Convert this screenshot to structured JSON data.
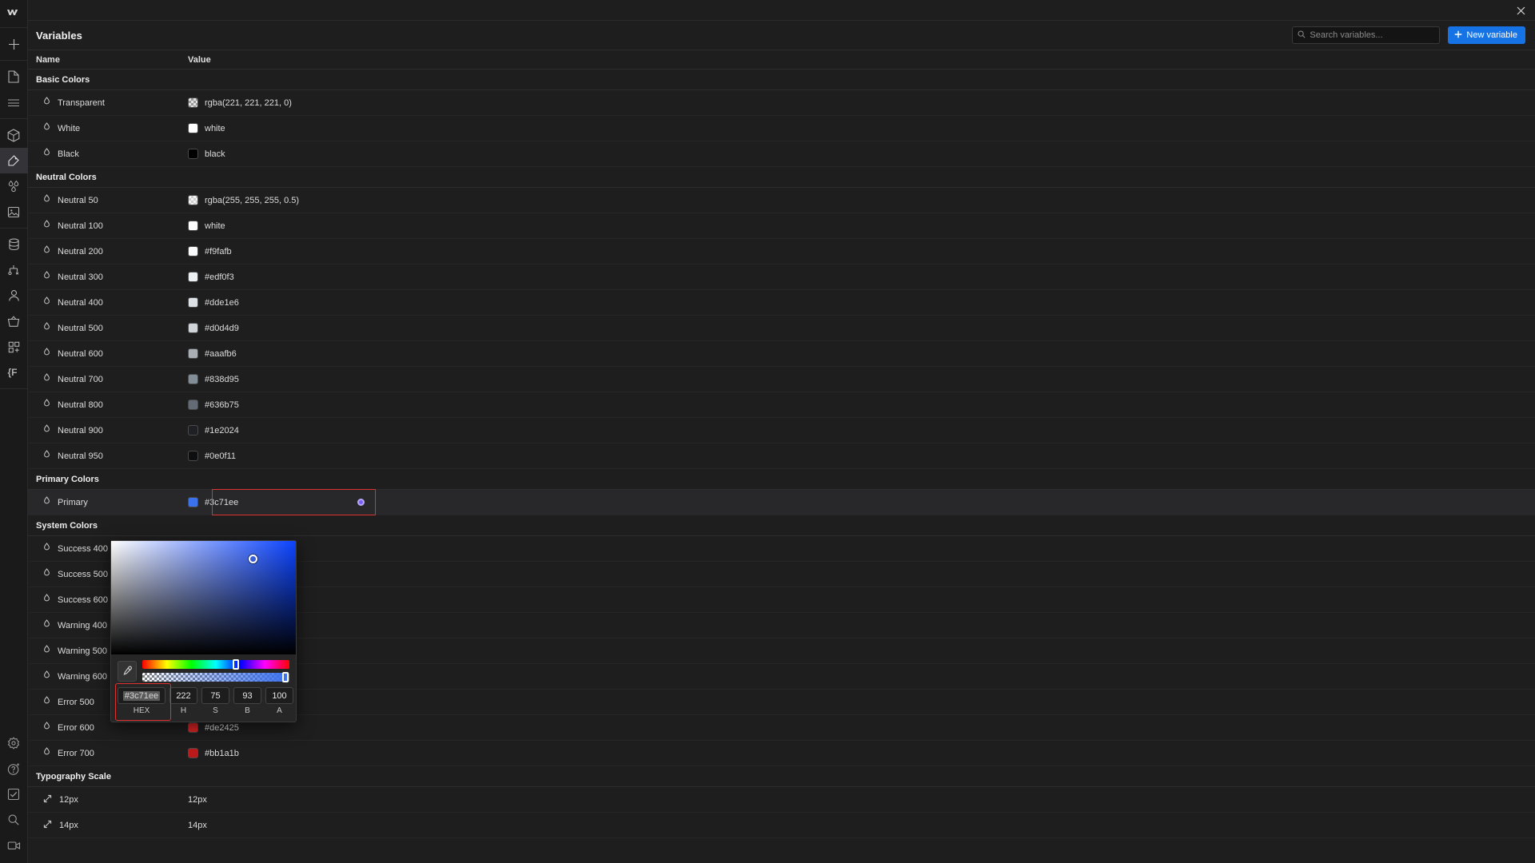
{
  "app": {
    "logo": "webflow-logo",
    "close_label": "×"
  },
  "toolbar": {
    "groups": [
      {
        "items": [
          {
            "name": "add-icon",
            "label": "Add"
          }
        ]
      },
      {
        "items": [
          {
            "name": "pages-icon",
            "label": "Pages"
          },
          {
            "name": "navigator-icon",
            "label": "Navigator"
          }
        ]
      },
      {
        "items": [
          {
            "name": "components-icon",
            "label": "Components"
          },
          {
            "name": "style-selector-icon",
            "label": "Style selector",
            "active": true
          },
          {
            "name": "variables-icon",
            "label": "Variables"
          },
          {
            "name": "assets-icon",
            "label": "Assets"
          }
        ]
      },
      {
        "items": [
          {
            "name": "cms-icon",
            "label": "CMS"
          },
          {
            "name": "logic-icon",
            "label": "Logic"
          },
          {
            "name": "users-icon",
            "label": "Users"
          },
          {
            "name": "ecommerce-icon",
            "label": "Ecommerce"
          },
          {
            "name": "apps-icon",
            "label": "Apps"
          },
          {
            "name": "code-icon",
            "label": "Custom code"
          }
        ]
      }
    ],
    "bottom": [
      {
        "name": "settings-icon",
        "label": "Settings"
      },
      {
        "name": "help-ai-icon",
        "label": "Help / AI"
      },
      {
        "name": "audit-icon",
        "label": "Audit"
      },
      {
        "name": "search-icon",
        "label": "Search"
      },
      {
        "name": "video-icon",
        "label": "Video tutorials"
      }
    ]
  },
  "header": {
    "title": "Variables",
    "search": {
      "placeholder": "Search variables...",
      "value": "",
      "icon": "search-icon"
    },
    "new_variable": {
      "label": "New variable",
      "icon": "plus-icon",
      "color": "#1673e6"
    }
  },
  "table": {
    "columns": {
      "name": "Name",
      "value": "Value"
    },
    "groups": [
      {
        "title": "Basic Colors",
        "rows": [
          {
            "name": "Transparent",
            "value": "rgba(221, 221, 221, 0)",
            "swatch": "transparent",
            "icon": "droplet-icon"
          },
          {
            "name": "White",
            "value": "white",
            "swatch": "#ffffff",
            "icon": "droplet-icon"
          },
          {
            "name": "Black",
            "value": "black",
            "swatch": "#000000",
            "icon": "droplet-icon"
          }
        ]
      },
      {
        "title": "Neutral Colors",
        "rows": [
          {
            "name": "Neutral 50",
            "value": "rgba(255, 255, 255, 0.5)",
            "swatch": "translucent-white",
            "icon": "droplet-icon"
          },
          {
            "name": "Neutral 100",
            "value": "white",
            "swatch": "#ffffff",
            "icon": "droplet-icon"
          },
          {
            "name": "Neutral 200",
            "value": "#f9fafb",
            "swatch": "#f9fafb",
            "icon": "droplet-icon"
          },
          {
            "name": "Neutral 300",
            "value": "#edf0f3",
            "swatch": "#edf0f3",
            "icon": "droplet-icon"
          },
          {
            "name": "Neutral 400",
            "value": "#dde1e6",
            "swatch": "#dde1e6",
            "icon": "droplet-icon"
          },
          {
            "name": "Neutral 500",
            "value": "#d0d4d9",
            "swatch": "#d0d4d9",
            "icon": "droplet-icon"
          },
          {
            "name": "Neutral 600",
            "value": "#aaafb6",
            "swatch": "#aaafb6",
            "icon": "droplet-icon"
          },
          {
            "name": "Neutral 700",
            "value": "#838d95",
            "swatch": "#838d95",
            "icon": "droplet-icon"
          },
          {
            "name": "Neutral 800",
            "value": "#636b75",
            "swatch": "#636b75",
            "icon": "droplet-icon"
          },
          {
            "name": "Neutral 900",
            "value": "#1e2024",
            "swatch": "#1e2024",
            "icon": "droplet-icon"
          },
          {
            "name": "Neutral 950",
            "value": "#0e0f11",
            "swatch": "#0e0f11",
            "icon": "droplet-icon"
          }
        ]
      },
      {
        "title": "Primary Colors",
        "rows": [
          {
            "name": "Primary",
            "value": "#3c71ee",
            "swatch": "#3c71ee",
            "icon": "droplet-icon",
            "selected": true,
            "has_dot": true
          }
        ]
      },
      {
        "title": "System Colors",
        "rows": [
          {
            "name": "Success 400",
            "value": "",
            "swatch": "",
            "icon": "droplet-icon"
          },
          {
            "name": "Success 500",
            "value": "",
            "swatch": "",
            "icon": "droplet-icon"
          },
          {
            "name": "Success 600",
            "value": "",
            "swatch": "",
            "icon": "droplet-icon"
          },
          {
            "name": "Warning 400",
            "value": "",
            "swatch": "",
            "icon": "droplet-icon"
          },
          {
            "name": "Warning 500",
            "value": "",
            "swatch": "",
            "icon": "droplet-icon"
          },
          {
            "name": "Warning 600",
            "value": "",
            "swatch": "",
            "icon": "droplet-icon"
          },
          {
            "name": "Error 500",
            "value": "",
            "swatch": "",
            "icon": "droplet-icon"
          },
          {
            "name": "Error 600",
            "value": "#de2425",
            "swatch": "#de2425",
            "icon": "droplet-icon"
          },
          {
            "name": "Error 700",
            "value": "#bb1a1b",
            "swatch": "#bb1a1b",
            "icon": "droplet-icon"
          }
        ]
      },
      {
        "title": "Typography Scale",
        "rows": [
          {
            "name": "12px",
            "value": "12px",
            "swatch": "",
            "icon": "size-arrow-icon"
          },
          {
            "name": "14px",
            "value": "14px",
            "swatch": "",
            "icon": "size-arrow-icon"
          }
        ]
      }
    ]
  },
  "color_picker": {
    "eyedropper_icon": "eyedropper-icon",
    "hex": {
      "label": "HEX",
      "value": "#3c71ee",
      "selected": true
    },
    "channels": [
      {
        "label": "H",
        "value": "222"
      },
      {
        "label": "S",
        "value": "75"
      },
      {
        "label": "B",
        "value": "93"
      },
      {
        "label": "A",
        "value": "100"
      }
    ],
    "current_color": "#3c71ee"
  }
}
